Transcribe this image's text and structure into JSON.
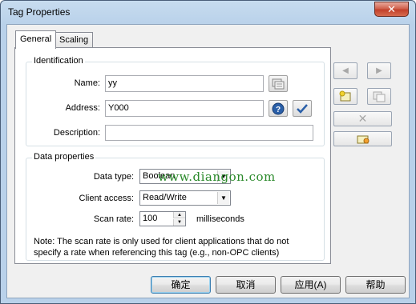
{
  "window": {
    "title": "Tag Properties",
    "close_glyph": "✕"
  },
  "tabs": [
    {
      "label": "General"
    },
    {
      "label": "Scaling"
    }
  ],
  "identification": {
    "legend": "Identification",
    "name_label": "Name:",
    "name_value": "yy",
    "address_label": "Address:",
    "address_value": "Y000",
    "description_label": "Description:",
    "description_value": ""
  },
  "data_properties": {
    "legend": "Data properties",
    "data_type_label": "Data type:",
    "data_type_value": "Boolean",
    "client_access_label": "Client access:",
    "client_access_value": "Read/Write",
    "scan_rate_label": "Scan rate:",
    "scan_rate_value": "100",
    "scan_rate_unit": "milliseconds",
    "note": "Note: The scan rate is only used for client applications that do not specify a rate when referencing this tag (e.g., non-OPC clients)"
  },
  "watermark": "www.diangon.com",
  "buttons": {
    "ok": "确定",
    "cancel": "取消",
    "apply": "应用(A)",
    "help": "帮助"
  },
  "icons": {
    "browse": "browse-tags-icon",
    "help": "help-icon",
    "check": "check-icon",
    "prev": "previous-icon",
    "next": "next-icon",
    "new_tag": "new-tag-icon",
    "duplicate": "duplicate-icon",
    "delete": "delete-icon",
    "auto_generate": "auto-generate-icon"
  },
  "colors": {
    "accent": "#2a5fa8",
    "watermark_green": "#2b8a2b",
    "title_bar": "#b9d1ea"
  }
}
